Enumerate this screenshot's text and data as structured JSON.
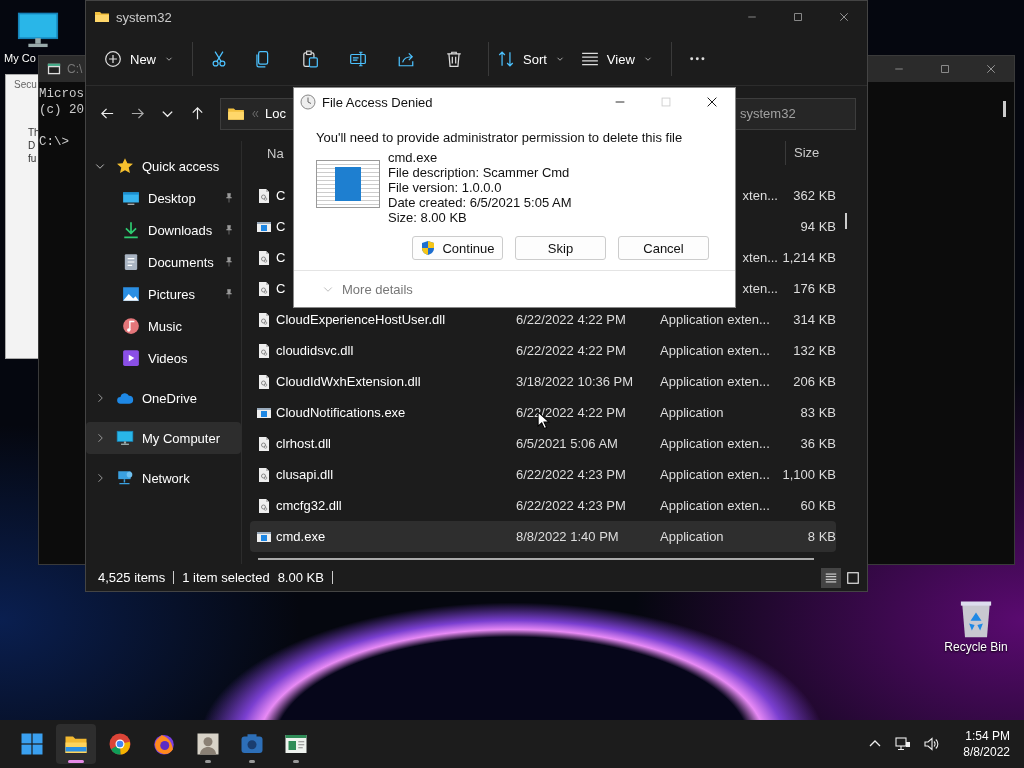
{
  "desktop": {
    "icons": [
      {
        "kind": "computer",
        "label": "My Co"
      },
      {
        "kind": "recycle",
        "label": "Recycle Bin"
      }
    ]
  },
  "security_window": {
    "title": "Secu",
    "lines": [
      "Th",
      "D",
      "fu"
    ]
  },
  "console_window": {
    "title": "C:\\",
    "lines": [
      "Micros",
      "(c) 20"
    ],
    "prompt": "C:\\>"
  },
  "explorer": {
    "title": "system32",
    "toolbar": [
      {
        "kind": "new",
        "label": "New",
        "dropdown": true
      },
      {
        "kind": "cut",
        "separator_before": true
      },
      {
        "kind": "copy"
      },
      {
        "kind": "paste"
      },
      {
        "kind": "rename"
      },
      {
        "kind": "share"
      },
      {
        "kind": "delete"
      },
      {
        "kind": "sort",
        "label": "Sort",
        "dropdown": true,
        "separator_before": true
      },
      {
        "kind": "view",
        "label": "View",
        "dropdown": true
      },
      {
        "kind": "more",
        "separator_before": true
      }
    ],
    "address": "Loc",
    "search": {
      "placeholder": "system32"
    },
    "sidebar": [
      {
        "kind": "star",
        "label": "Quick access",
        "expanded": true,
        "selected": false,
        "children": [
          {
            "kind": "desktop",
            "label": "Desktop",
            "pinned": true,
            "selected": false
          },
          {
            "kind": "download",
            "label": "Downloads",
            "pinned": true,
            "selected": false
          },
          {
            "kind": "document",
            "label": "Documents",
            "pinned": true,
            "selected": false
          },
          {
            "kind": "picture",
            "label": "Pictures",
            "pinned": true,
            "selected": false
          },
          {
            "kind": "music",
            "label": "Music",
            "pinned": false,
            "selected": false
          },
          {
            "kind": "video",
            "label": "Videos",
            "pinned": false,
            "selected": false
          }
        ]
      },
      {
        "kind": "cloud",
        "label": "OneDrive",
        "expanded": false,
        "selected": false
      },
      {
        "kind": "computer",
        "label": "My Computer",
        "expanded": false,
        "selected": true
      },
      {
        "kind": "network",
        "label": "Network",
        "expanded": false,
        "selected": false
      }
    ],
    "columns": [
      "Na",
      "Size"
    ],
    "rows": [
      {
        "kind": "dll",
        "name": "C",
        "type": "xten...",
        "size": "362 KB",
        "selected": false
      },
      {
        "kind": "exe",
        "name": "C",
        "size": "94 KB",
        "selected": false
      },
      {
        "kind": "dll",
        "name": "C",
        "type": "xten...",
        "size": "1,214 KB",
        "selected": false
      },
      {
        "kind": "dll",
        "name": "C",
        "type": "xten...",
        "size": "176 KB",
        "selected": false
      },
      {
        "kind": "dll",
        "name": "CloudExperienceHostUser.dll",
        "date": "6/22/2022 4:22 PM",
        "type": "Application exten...",
        "size": "314 KB",
        "selected": false
      },
      {
        "kind": "dll",
        "name": "cloudidsvc.dll",
        "date": "6/22/2022 4:22 PM",
        "type": "Application exten...",
        "size": "132 KB",
        "selected": false
      },
      {
        "kind": "dll",
        "name": "CloudIdWxhExtension.dll",
        "date": "3/18/2022 10:36 PM",
        "type": "Application exten...",
        "size": "206 KB",
        "selected": false
      },
      {
        "kind": "exe",
        "name": "CloudNotifications.exe",
        "date": "6/22/2022 4:22 PM",
        "type": "Application",
        "size": "83 KB",
        "selected": false
      },
      {
        "kind": "dll",
        "name": "clrhost.dll",
        "date": "6/5/2021 5:06 AM",
        "type": "Application exten...",
        "size": "36 KB",
        "selected": false
      },
      {
        "kind": "dll",
        "name": "clusapi.dll",
        "date": "6/22/2022 4:23 PM",
        "type": "Application exten...",
        "size": "1,100 KB",
        "selected": false
      },
      {
        "kind": "dll",
        "name": "cmcfg32.dll",
        "date": "6/22/2022 4:23 PM",
        "type": "Application exten...",
        "size": "60 KB",
        "selected": false
      },
      {
        "kind": "exe",
        "name": "cmd.exe",
        "date": "8/8/2022 1:40 PM",
        "type": "Application",
        "size": "8 KB",
        "selected": true
      }
    ],
    "status": [
      "4,525 items",
      "1 item selected",
      "8.00 KB"
    ],
    "views": [
      {
        "kind": "details",
        "selected": true
      },
      {
        "kind": "tiles",
        "selected": false
      }
    ]
  },
  "dialog": {
    "title": "File Access Denied",
    "controls": [
      {
        "kind": "minimize",
        "disabled": false
      },
      {
        "kind": "maximize",
        "disabled": true
      },
      {
        "kind": "close",
        "disabled": false
      }
    ],
    "message": "You'll need to provide administrator permission to delete this file",
    "file": {
      "name": "cmd.exe",
      "details": [
        "File description: Scammer Cmd",
        "File version: 1.0.0.0",
        "Date created: 6/5/2021 5:05 AM",
        "Size: 8.00 KB"
      ]
    },
    "buttons": [
      {
        "kind": "elevated",
        "label": "Continue"
      },
      {
        "kind": "plain",
        "label": "Skip"
      },
      {
        "kind": "plain",
        "label": "Cancel"
      }
    ],
    "more_details": {
      "label": "More details",
      "expanded": false
    }
  },
  "taskbar": {
    "apps": [
      {
        "kind": "start",
        "running": false,
        "active": false
      },
      {
        "kind": "explorer",
        "running": true,
        "active": true
      },
      {
        "kind": "chrome",
        "running": false,
        "active": false
      },
      {
        "kind": "firefox",
        "running": false,
        "active": false
      },
      {
        "kind": "photo",
        "running": true,
        "active": false
      },
      {
        "kind": "camera",
        "running": true,
        "active": false
      },
      {
        "kind": "app",
        "running": true,
        "active": false
      }
    ],
    "tray": [
      {
        "kind": "chevron"
      },
      {
        "kind": "network"
      },
      {
        "kind": "volume"
      }
    ],
    "time": "1:54 PM",
    "date": "8/8/2022"
  }
}
